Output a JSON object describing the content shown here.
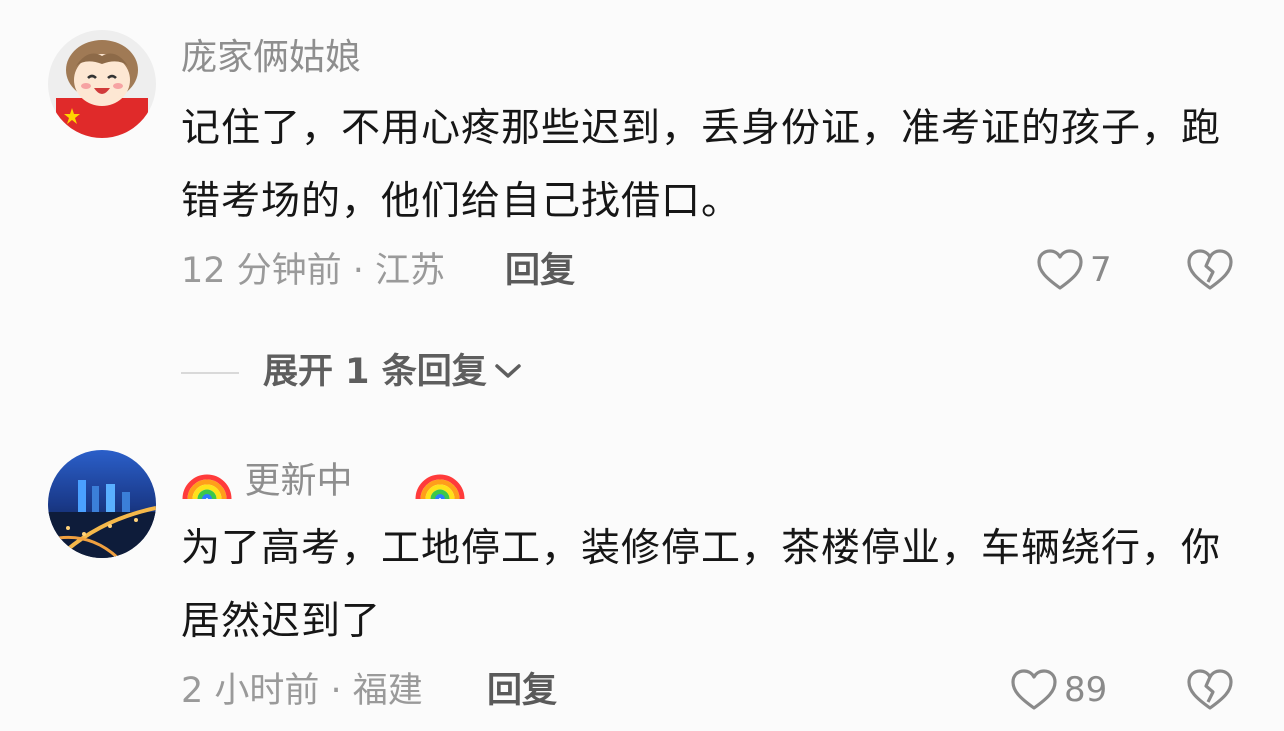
{
  "comments": [
    {
      "username": "庞家俩姑娘",
      "text": "记住了，不用心疼那些迟到，丢身份证，准考证的孩子，跑错考场的，他们给自己找借口。",
      "time_location": "12 分钟前 · 江苏",
      "reply_label": "回复",
      "like_count": "7",
      "expand_label": "展开 1 条回复"
    },
    {
      "username_prefix_emoji": "rainbow",
      "username": "更新中",
      "username_suffix_emoji": "rainbow",
      "text": "为了高考，工地停工，装修停工，茶楼停业，车辆绕行，你居然迟到了",
      "time_location": "2 小时前 · 福建",
      "reply_label": "回复",
      "like_count": "89"
    }
  ],
  "icons": {
    "like": "heart-outline-icon",
    "dislike": "broken-heart-icon",
    "expand": "chevron-down-icon"
  },
  "colors": {
    "background": "#fbfbfb",
    "text": "#161616",
    "muted": "#9a9a9a",
    "accent_flag": "#e02a2a"
  }
}
